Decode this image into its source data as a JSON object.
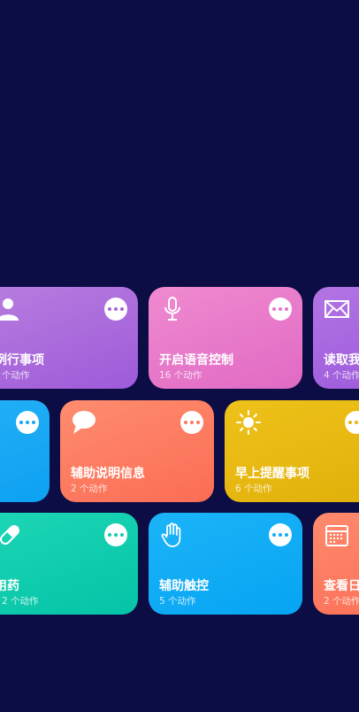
{
  "cards": [
    {
      "title": "例行事项",
      "count": "个动作",
      "icon": "person-icon",
      "color": "#a865dc"
    },
    {
      "title": "开启语音控制",
      "count": "16 个动作",
      "icon": "microphone-icon",
      "color": "#e677c9"
    },
    {
      "title": "读取我",
      "count": "4 个动作",
      "icon": "envelope-icon",
      "color": "#a461de"
    },
    {
      "title": "",
      "count": "",
      "icon": "",
      "color": "#11a8f4"
    },
    {
      "title": "辅助说明信息",
      "count": "2 个动作",
      "icon": "speech-bubble-icon",
      "color": "#fc7b5f"
    },
    {
      "title": "早上提醒事项",
      "count": "6 个动作",
      "icon": "sun-icon",
      "color": "#e7b810"
    },
    {
      "title": "用药",
      "count": "2 个动作",
      "icon": "pill-icon",
      "color": "#0fcbad"
    },
    {
      "title": "辅助触控",
      "count": "5 个动作",
      "icon": "hand-icon",
      "color": "#11aaf4"
    },
    {
      "title": "查看日",
      "count": "2 个动作",
      "icon": "calendar-icon",
      "color": "#fc785d"
    }
  ]
}
